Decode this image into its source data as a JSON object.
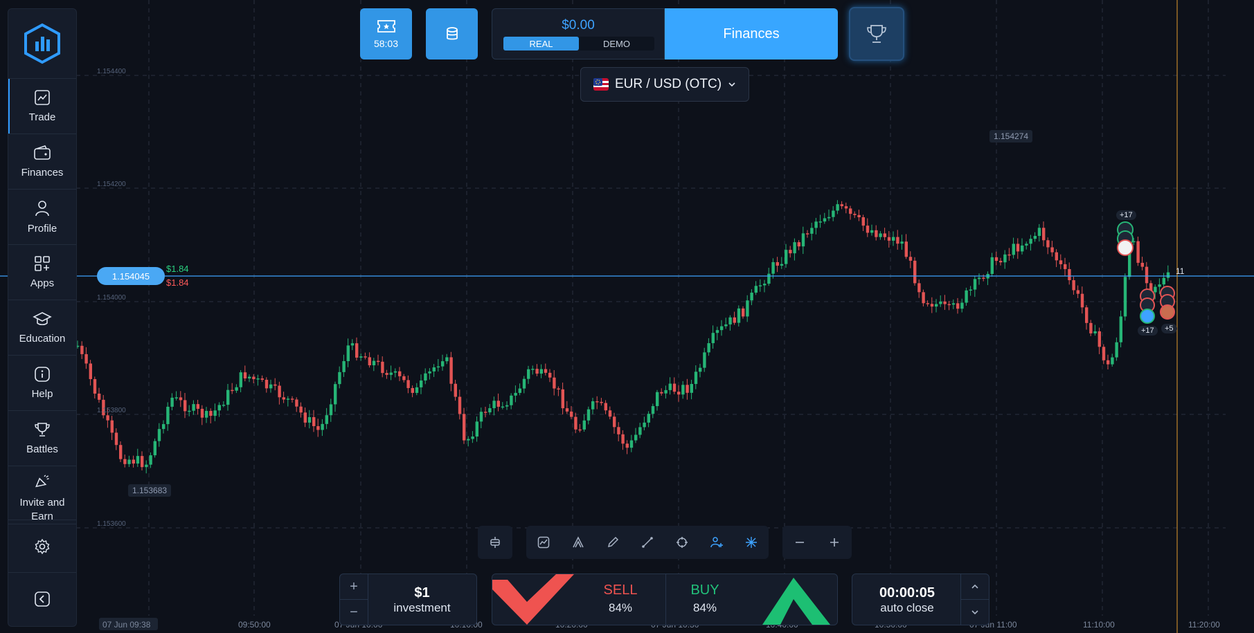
{
  "sidebar": {
    "items": [
      {
        "label": "Trade",
        "icon": "chart-line-icon"
      },
      {
        "label": "Finances",
        "icon": "wallet-icon"
      },
      {
        "label": "Profile",
        "icon": "user-icon"
      },
      {
        "label": "Apps",
        "icon": "apps-grid-icon"
      },
      {
        "label": "Education",
        "icon": "graduation-cap-icon"
      },
      {
        "label": "Help",
        "icon": "info-icon"
      },
      {
        "label": "Battles",
        "icon": "trophy-icon"
      },
      {
        "label": "Invite and Earn",
        "icon": "megaphone-icon"
      }
    ]
  },
  "header": {
    "ticket_time": "58:03",
    "balance": "$0.00",
    "account_real": "REAL",
    "account_demo": "DEMO",
    "finances_label": "Finances",
    "asset": "EUR / USD (OTC)"
  },
  "chart_data": {
    "type": "candlestick",
    "current_price": "1.154045",
    "payout_up": "$1.84",
    "payout_down": "$1.84",
    "high_label": "1.154274",
    "low_label": "1.153683",
    "price_ticks": [
      "1.154400",
      "1.154200",
      "1.154000",
      "1.153800",
      "1.153600"
    ],
    "time_ticks": [
      "07 Jun 09:38",
      "09:50:00",
      "07 Jun 10:00",
      "10:10:00",
      "10:20:00",
      "07 Jun 10:30",
      "10:40:00",
      "10:50:00",
      "07 Jun 11:00",
      "11:10:00",
      "11:20:00"
    ],
    "trader_badges": {
      "top": "+17",
      "left": "+17",
      "right": "+5",
      "count": "11"
    }
  },
  "trade": {
    "investment_amount": "$1",
    "investment_label": "investment",
    "plus": "+",
    "minus": "−",
    "sell_label": "SELL",
    "sell_pct": "84%",
    "buy_label": "BUY",
    "buy_pct": "84%",
    "timer": "00:00:05",
    "timer_label": "auto close"
  },
  "colors": {
    "accent": "#38a6ff",
    "up": "#26b576",
    "down": "#e25454",
    "background": "#0d111a"
  }
}
